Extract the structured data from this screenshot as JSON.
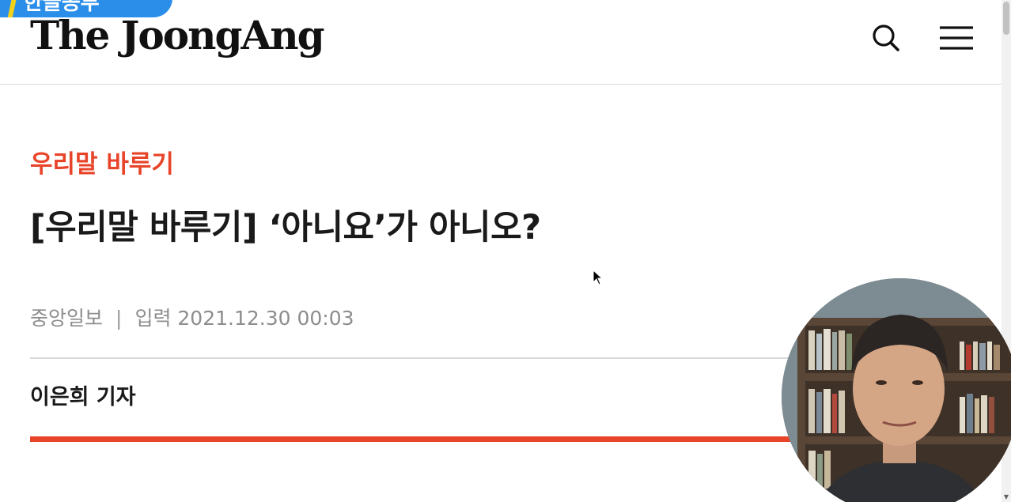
{
  "header": {
    "badge_text": "한글공부",
    "logo_text": "The JoongAng",
    "search_icon": "search-icon",
    "menu_icon": "hamburger-menu-icon"
  },
  "article": {
    "category": "우리말 바루기",
    "headline": "[우리말 바루기] ‘아니요’가 아니오?",
    "publisher": "중앙일보",
    "separator": "|",
    "published": "입력 2021.12.30 00:03",
    "reporter": "이은희 기자"
  },
  "colors": {
    "accent": "#e8442a",
    "badge": "#2b8fea",
    "text": "#1a1a1a",
    "meta": "#8d8d8d"
  },
  "overlay": {
    "webcam_icon": "presenter-webcam"
  }
}
